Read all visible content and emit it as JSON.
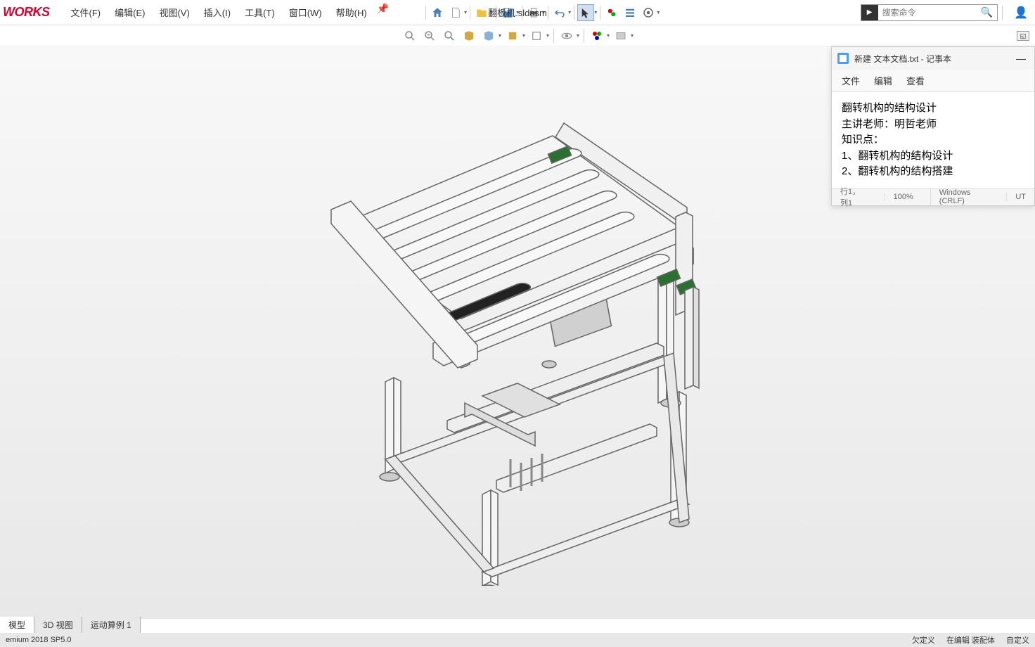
{
  "app_logo": "WORKS",
  "document_title": "翻板机.sldasm",
  "menu": {
    "file": "文件(F)",
    "edit": "编辑(E)",
    "view": "视图(V)",
    "insert": "插入(I)",
    "tools": "工具(T)",
    "window": "窗口(W)",
    "help": "帮助(H)"
  },
  "search": {
    "placeholder": "搜索命令"
  },
  "notepad": {
    "title": "新建 文本文档.txt - 记事本",
    "menu_file": "文件",
    "menu_edit": "编辑",
    "menu_view": "查看",
    "content": "翻转机构的结构设计\n主讲老师：明哲老师\n知识点：\n1、翻转机构的结构设计\n2、翻转机构的结构搭建",
    "status_pos": "行1，列1",
    "status_zoom": "100%",
    "status_encoding": "Windows (CRLF)",
    "status_format": "UT"
  },
  "tabs": {
    "model": "模型",
    "view3d": "3D 视图",
    "motion": "运动算例 1"
  },
  "bottom_bar": {
    "version": "emium 2018 SP5.0",
    "status1": "欠定义",
    "status2": "在编辑 装配体",
    "status3": "自定义"
  }
}
